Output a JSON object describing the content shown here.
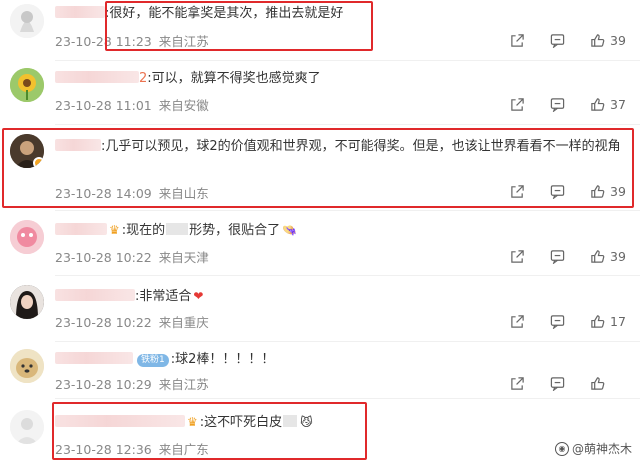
{
  "comments": [
    {
      "text": ":很好，能不能拿奖是其次，推出去就是好",
      "date": "23-10-28 11:23",
      "location": "来自江苏",
      "likes": "39",
      "highlighted": true
    },
    {
      "text_suffix": "2",
      "text": ":可以，就算不得奖也感觉爽了",
      "date": "23-10-28 11:01",
      "location": "来自安徽",
      "likes": "37",
      "highlighted": false
    },
    {
      "text": ":几乎可以预见，球2的价值观和世界观，不可能得奖。但是，也该让世界看看不一样的视角",
      "date": "23-10-28 14:09",
      "location": "来自山东",
      "likes": "39",
      "highlighted": true
    },
    {
      "text_before": ":现在的",
      "text_after": "形势，很贴合了",
      "date": "23-10-28 10:22",
      "location": "来自天津",
      "likes": "39",
      "highlighted": false
    },
    {
      "text": ":非常适合",
      "date": "23-10-28 10:22",
      "location": "来自重庆",
      "likes": "17",
      "highlighted": false
    },
    {
      "badge": "铁粉1",
      "text": ":球2棒！！！！！",
      "date": "23-10-28 10:29",
      "location": "来自江苏",
      "likes": "",
      "highlighted": false
    },
    {
      "text": ":这不吓死白皮",
      "date": "23-10-28 12:36",
      "location": "来自广东",
      "likes": "",
      "highlighted": true
    }
  ],
  "watermark": "@萌神杰木",
  "colors": {
    "highlight_border": "#e0292b",
    "meta_text": "#888888",
    "body_text": "#333333"
  },
  "icons": [
    "share-icon",
    "comment-icon",
    "like-icon"
  ]
}
